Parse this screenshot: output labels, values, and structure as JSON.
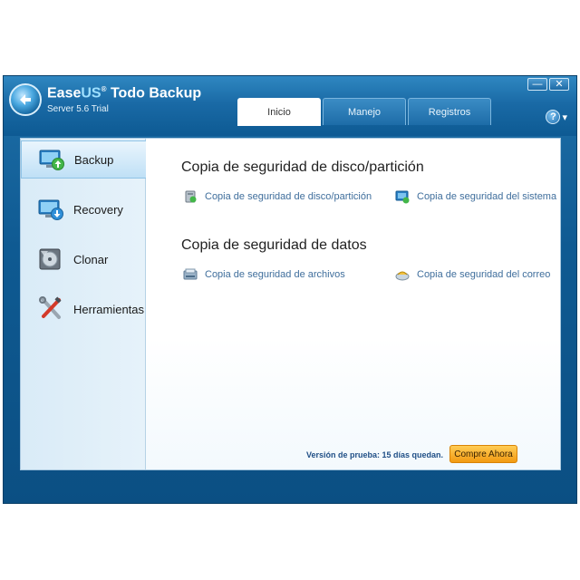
{
  "app": {
    "title_part1": "Ease",
    "title_part2": "US",
    "title_reg": "®",
    "title_part3": " Todo Backup",
    "subtitle": "Server 5.6 Trial"
  },
  "window_controls": {
    "minimize": "—",
    "close": "✕"
  },
  "help": {
    "symbol": "?",
    "caret": "▾"
  },
  "tabs": [
    {
      "label": "Inicio",
      "active": true
    },
    {
      "label": "Manejo",
      "active": false
    },
    {
      "label": "Registros",
      "active": false
    }
  ],
  "sidebar": {
    "items": [
      {
        "label": "Backup",
        "icon": "monitor-backup-icon",
        "active": true
      },
      {
        "label": "Recovery",
        "icon": "monitor-recovery-icon",
        "active": false
      },
      {
        "label": "Clonar",
        "icon": "disk-clone-icon",
        "active": false
      },
      {
        "label": "Herramientas",
        "icon": "tools-icon",
        "active": false
      }
    ]
  },
  "sections": [
    {
      "title": "Copia de seguridad de disco/partición",
      "links": [
        {
          "label": "Copia de seguridad de disco/partición",
          "icon": "disk-backup-icon"
        },
        {
          "label": "Copia de seguridad del sistema",
          "icon": "system-backup-icon"
        }
      ]
    },
    {
      "title": "Copia de seguridad de datos",
      "links": [
        {
          "label": "Copia de seguridad de archivos",
          "icon": "file-backup-icon"
        },
        {
          "label": "Copia de seguridad del correo",
          "icon": "mail-backup-icon"
        }
      ]
    }
  ],
  "footer": {
    "trial_text": "Versión de prueba: 15 días quedan.",
    "buy_label": "Compre Ahora"
  },
  "colors": {
    "accent": "#1a6aa6",
    "link": "#3f6e9c",
    "buy": "#f29a12"
  }
}
